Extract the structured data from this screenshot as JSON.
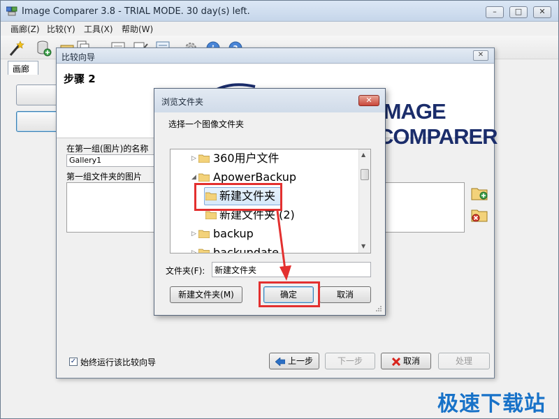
{
  "window": {
    "title": "Image Comparer 3.8 - TRIAL MODE. 30 day(s) left.",
    "minimize_label": "–",
    "maximize_label": "□",
    "close_label": "✕"
  },
  "menu": [
    "画廊(Z)",
    "比较(Y)",
    "工具(X)",
    "帮助(W)"
  ],
  "tab": "画廊",
  "wizard": {
    "title": "比较向导",
    "close_label": "✕",
    "step": "步骤 2",
    "logo": "IMAGE COMPARER",
    "group_name_label": "在第一组(图片)的名称",
    "group_name_value": "Gallery1",
    "group_images_label": "第一组文件夹的图片",
    "always_run_label": "始终运行该比较向导",
    "always_run_checked": true,
    "buttons": {
      "back": "上一步",
      "next": "下一步",
      "cancel": "取消",
      "process": "处理"
    }
  },
  "dialog": {
    "title": "浏览文件夹",
    "close_label": "✕",
    "description": "选择一个图像文件夹",
    "tree": [
      {
        "label": "360用户文件",
        "expanded": false
      },
      {
        "label": "ApowerBackup",
        "expanded": true
      },
      {
        "label": "新建文件夹",
        "selected": true
      },
      {
        "label": "新建文件夹 (2)"
      },
      {
        "label": "backup",
        "expanded": false
      },
      {
        "label": "backupdate",
        "expanded": false
      }
    ],
    "folder_label": "文件夹(F):",
    "folder_value": "新建文件夹",
    "new_folder_button": "新建文件夹(M)",
    "ok_button": "确定",
    "cancel_button": "取消"
  },
  "watermark": "极速下载站",
  "colors": {
    "highlight": "#e3302f",
    "logo": "#1b2d6b",
    "watermark": "#1872c8"
  }
}
